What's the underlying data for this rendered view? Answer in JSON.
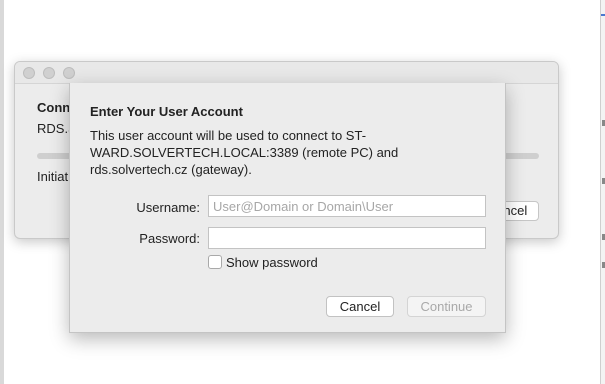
{
  "back_window": {
    "heading": "Connecting to",
    "host_prefix": "RDS.SOLVERTECH",
    "status": "Initiating remote connection...",
    "cancel_label": "Cancel"
  },
  "sheet": {
    "title": "Enter Your User Account",
    "description": "This user account will be used to connect to ST-WARD.SOLVERTECH.LOCAL:3389 (remote PC) and rds.solvertech.cz (gateway).",
    "username_label": "Username:",
    "username_value": "",
    "username_placeholder": "User@Domain or Domain\\User",
    "password_label": "Password:",
    "password_value": "",
    "show_password_label": "Show password",
    "show_password_checked": false,
    "cancel_label": "Cancel",
    "continue_label": "Continue"
  }
}
